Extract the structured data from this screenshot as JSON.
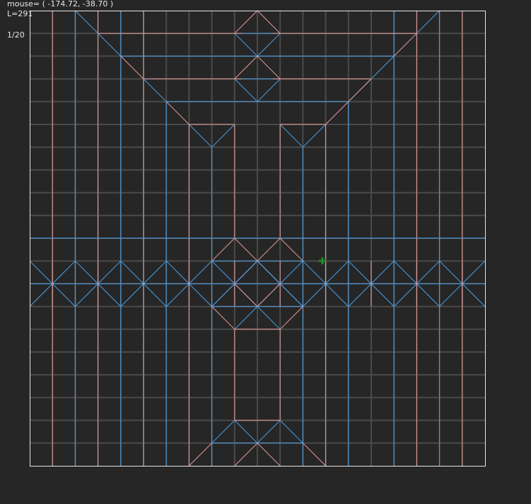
{
  "hud": {
    "mouse_readout": "mouse= ( -174.72, -38.70 )",
    "length_readout": "L=291",
    "grid_division": "1/20"
  },
  "colors": {
    "background": "#262626",
    "grid": "#4a4a4a",
    "border": "#e6e6e6",
    "mountain": "#e89a9a",
    "valley": "#4aa0e6",
    "marker": "#1e8c1e"
  },
  "icons": {
    "cursor_marker": "green-cross-icon"
  }
}
